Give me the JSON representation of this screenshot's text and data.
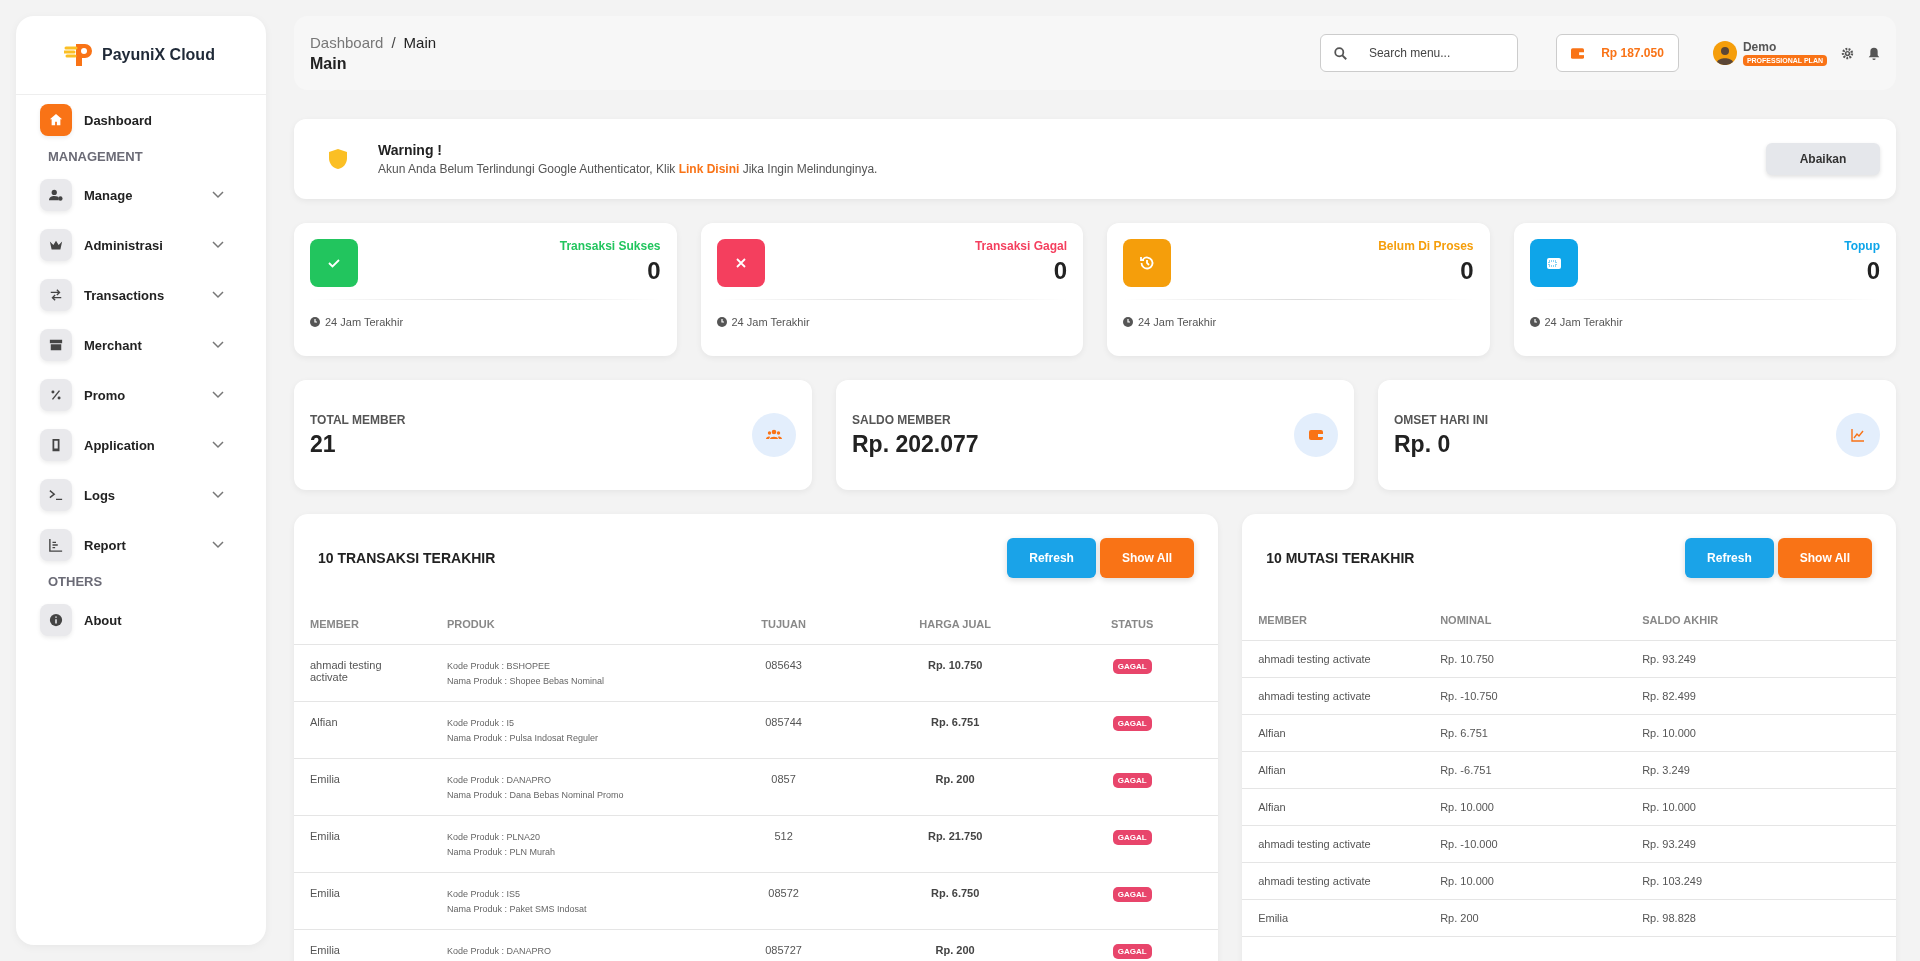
{
  "brand": {
    "name": "PayuniX Cloud"
  },
  "sidebar": [
    {
      "items": [
        {
          "label": "Dashboard",
          "selected": true,
          "expandable": false
        }
      ]
    },
    {
      "heading": "MANAGEMENT",
      "items": [
        {
          "label": "Manage",
          "selected": false,
          "expandable": true
        },
        {
          "label": "Administrasi",
          "selected": false,
          "expandable": true
        },
        {
          "label": "Transactions",
          "selected": false,
          "expandable": true
        },
        {
          "label": "Merchant",
          "selected": false,
          "expandable": true
        },
        {
          "label": "Promo",
          "selected": false,
          "expandable": true
        },
        {
          "label": "Application",
          "selected": false,
          "expandable": true
        },
        {
          "label": "Logs",
          "selected": false,
          "expandable": true
        },
        {
          "label": "Report",
          "selected": false,
          "expandable": true
        }
      ]
    },
    {
      "heading": "OTHERS",
      "items": [
        {
          "label": "About",
          "selected": false,
          "expandable": false
        }
      ]
    }
  ],
  "header": {
    "breadcrumb": [
      "Dashboard",
      "Main"
    ],
    "breadcrumb_separator": "/",
    "page_title": "Main",
    "search": {
      "placeholder": "Search menu..."
    },
    "balance": "Rp 187.050",
    "user": {
      "name": "Demo",
      "plan": "PROFESSIONAL PLAN"
    }
  },
  "warning": {
    "title": "Warning !",
    "message_before": "Akun Anda Belum Terlindungi Google Authenticator, Klik",
    "link": "Link Disini",
    "message_after": "Jika Ingin Melindunginya.",
    "button": "Abaikan"
  },
  "stats": [
    {
      "label": "Transaksi Sukses",
      "value": "0",
      "color": "#22c55e",
      "footer": "24 Jam Terakhir"
    },
    {
      "label": "Transaksi Gagal",
      "value": "0",
      "color": "#f43f5e",
      "footer": "24 Jam Terakhir"
    },
    {
      "label": "Belum Di Proses",
      "value": "0",
      "color": "#f59e0b",
      "footer": "24 Jam Terakhir"
    },
    {
      "label": "Topup",
      "value": "0",
      "color": "#0ea5e9",
      "footer": "24 Jam Terakhir"
    }
  ],
  "summary": [
    {
      "label": "TOTAL MEMBER",
      "value": "21"
    },
    {
      "label": "SALDO MEMBER",
      "value": "Rp. 202.077"
    },
    {
      "label": "OMSET HARI INI",
      "value": "Rp. 0"
    }
  ],
  "transactions": {
    "title": "10 TRANSAKSI TERAKHIR",
    "buttons": [
      "Refresh",
      "Show All"
    ],
    "columns": [
      "MEMBER",
      "PRODUK",
      "TUJUAN",
      "HARGA JUAL",
      "STATUS"
    ],
    "rows": [
      {
        "member": "ahmadi testing activate",
        "produk": [
          "Kode Produk : BSHOPEE",
          "Nama Produk : Shopee Bebas Nominal"
        ],
        "tujuan": "085643",
        "harga": "Rp. 10.750",
        "status": "GAGAL"
      },
      {
        "member": "Alfian",
        "produk": [
          "Kode Produk : I5",
          "Nama Produk : Pulsa Indosat Reguler"
        ],
        "tujuan": "085744",
        "harga": "Rp. 6.751",
        "status": "GAGAL"
      },
      {
        "member": "Emilia",
        "produk": [
          "Kode Produk : DANAPRO",
          "Nama Produk : Dana Bebas Nominal Promo"
        ],
        "tujuan": "0857",
        "harga": "Rp. 200",
        "status": "GAGAL"
      },
      {
        "member": "Emilia",
        "produk": [
          "Kode Produk : PLNA20",
          "Nama Produk : PLN Murah"
        ],
        "tujuan": "512",
        "harga": "Rp. 21.750",
        "status": "GAGAL"
      },
      {
        "member": "Emilia",
        "produk": [
          "Kode Produk : IS5",
          "Nama Produk : Paket SMS Indosat"
        ],
        "tujuan": "08572",
        "harga": "Rp. 6.750",
        "status": "GAGAL"
      },
      {
        "member": "Emilia",
        "produk": [
          "Kode Produk : DANAPRO"
        ],
        "tujuan": "085727",
        "harga": "Rp. 200",
        "status": "GAGAL"
      }
    ]
  },
  "mutations": {
    "title": "10 MUTASI TERAKHIR",
    "buttons": [
      "Refresh",
      "Show All"
    ],
    "columns": [
      "MEMBER",
      "NOMINAL",
      "SALDO AKHIR"
    ],
    "rows": [
      [
        "ahmadi testing activate",
        "Rp. 10.750",
        "Rp. 93.249"
      ],
      [
        "ahmadi testing activate",
        "Rp. -10.750",
        "Rp. 82.499"
      ],
      [
        "Alfian",
        "Rp. 6.751",
        "Rp. 10.000"
      ],
      [
        "Alfian",
        "Rp. -6.751",
        "Rp. 3.249"
      ],
      [
        "Alfian",
        "Rp. 10.000",
        "Rp. 10.000"
      ],
      [
        "ahmadi testing activate",
        "Rp. -10.000",
        "Rp. 93.249"
      ],
      [
        "ahmadi testing activate",
        "Rp. 10.000",
        "Rp. 103.249"
      ],
      [
        "Emilia",
        "Rp. 200",
        "Rp. 98.828"
      ]
    ]
  }
}
